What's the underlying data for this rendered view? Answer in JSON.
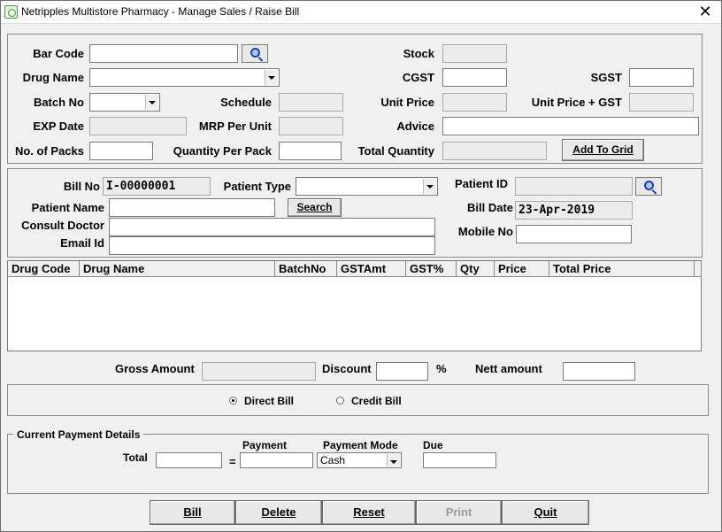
{
  "window": {
    "title": "Netripples Multistore Pharmacy  - Manage Sales / Raise Bill",
    "close_symbol": "✕"
  },
  "drug_entry": {
    "barcode_label": "Bar Code",
    "barcode_value": "",
    "drug_name_label": "Drug Name",
    "drug_name_value": "",
    "batch_no_label": "Batch No",
    "batch_no_value": "",
    "exp_date_label": "EXP Date",
    "exp_date_value": "",
    "no_of_packs_label": "No. of Packs",
    "no_of_packs_value": "",
    "schedule_label": "Schedule",
    "schedule_value": "",
    "mrp_per_unit_label": "MRP Per Unit",
    "mrp_per_unit_value": "",
    "qty_per_pack_label": "Quantity Per Pack",
    "qty_per_pack_value": "",
    "stock_label": "Stock",
    "stock_value": "",
    "cgst_label": "CGST",
    "cgst_value": "",
    "sgst_label": "SGST",
    "sgst_value": "",
    "unit_price_label": "Unit Price",
    "unit_price_value": "",
    "unit_price_gst_label": "Unit Price + GST",
    "unit_price_gst_value": "",
    "advice_label": "Advice",
    "advice_value": "",
    "total_qty_label": "Total Quantity",
    "total_qty_value": "",
    "add_to_grid_label": "Add To Grid"
  },
  "patient": {
    "bill_no_label": "Bill No",
    "bill_no_value": "I-00000001",
    "patient_type_label": "Patient Type",
    "patient_type_value": "",
    "patient_id_label": "Patient ID",
    "patient_id_value": "",
    "patient_name_label": "Patient  Name",
    "patient_name_value": "",
    "search_label": "Search",
    "bill_date_label": "Bill Date",
    "bill_date_value": "23-Apr-2019",
    "consult_doctor_label": "Consult Doctor",
    "consult_doctor_value": "",
    "mobile_no_label": "Mobile No",
    "mobile_no_value": "",
    "email_label": "Email Id",
    "email_value": ""
  },
  "grid": {
    "columns": [
      "Drug Code",
      "Drug Name",
      "BatchNo",
      "GSTAmt",
      "GST%",
      "Qty",
      "Price",
      "Total Price"
    ],
    "rows": []
  },
  "totals": {
    "gross_amount_label": "Gross Amount",
    "gross_amount_value": "",
    "discount_label": "Discount",
    "discount_value": "",
    "percent_symbol": "%",
    "nett_amount_label": "Nett amount",
    "nett_amount_value": ""
  },
  "bill_type": {
    "direct_bill_label": "Direct Bill",
    "credit_bill_label": "Credit Bill",
    "selected": "Direct Bill"
  },
  "payment": {
    "group_title": "Current Payment Details",
    "total_label": "Total",
    "total_value": "",
    "equals_symbol": "=",
    "payment_label": "Payment",
    "payment_value": "",
    "payment_mode_label": "Payment Mode",
    "payment_mode_value": "Cash",
    "due_label": "Due",
    "due_value": ""
  },
  "actions": {
    "bill_label": "Bill",
    "delete_label": "Delete",
    "reset_label": "Reset",
    "print_label": "Print",
    "quit_label": "Quit"
  }
}
